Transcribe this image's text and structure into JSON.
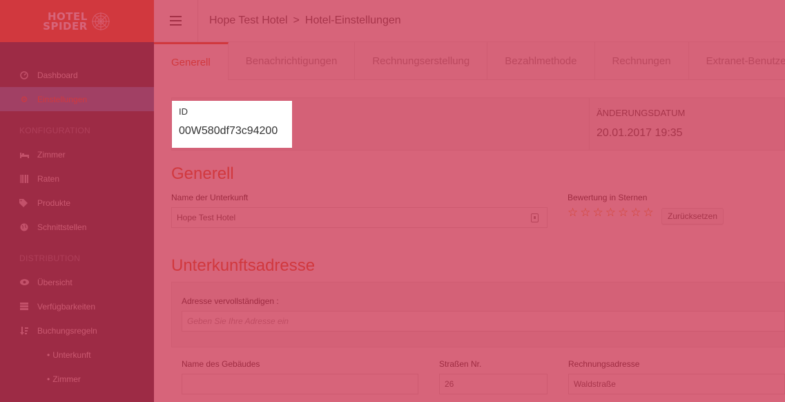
{
  "logo": {
    "line1": "HOTEL",
    "line2": "SPIDER"
  },
  "sidebar": {
    "items": [
      {
        "label": "Dashboard",
        "icon": "dashboard-icon",
        "active": false
      },
      {
        "label": "Einstellungen",
        "icon": "gear-icon",
        "active": true
      }
    ],
    "sections": [
      {
        "title": "KONFIGURATION",
        "items": [
          {
            "label": "Zimmer",
            "icon": "bed-icon"
          },
          {
            "label": "Raten",
            "icon": "barcode-icon"
          },
          {
            "label": "Produkte",
            "icon": "tags-icon"
          },
          {
            "label": "Schnittstellen",
            "icon": "globe-icon"
          }
        ]
      },
      {
        "title": "DISTRIBUTION",
        "items": [
          {
            "label": "Übersicht",
            "icon": "eye-icon"
          },
          {
            "label": "Verfügbarkeiten",
            "icon": "list-icon"
          },
          {
            "label": "Buchungsregeln",
            "icon": "sort-icon"
          }
        ],
        "subitems": [
          {
            "label": "Unterkunft"
          },
          {
            "label": "Zimmer"
          }
        ]
      }
    ]
  },
  "breadcrumb": {
    "hotel": "Hope Test Hotel",
    "separator": ">",
    "page": "Hotel-Einstellungen"
  },
  "tabs": [
    {
      "label": "Generell",
      "active": true
    },
    {
      "label": "Benachrichtigungen",
      "active": false
    },
    {
      "label": "Rechnungserstellung",
      "active": false
    },
    {
      "label": "Bezahlmethode",
      "active": false
    },
    {
      "label": "Rechnungen",
      "active": false
    },
    {
      "label": "Extranet-Benutzer",
      "active": false
    }
  ],
  "meta": {
    "id_label": "ID",
    "id_value": "00W580df73c94200",
    "date_label": "ÄNDERUNGSDATUM",
    "date_value": "20.01.2017 19:35"
  },
  "general": {
    "title": "Generell",
    "name_label": "Name der Unterkunft",
    "name_value": "Hope Test Hotel",
    "rating_label": "Bewertung in Sternen",
    "star_count": 7,
    "star_glyph": "☆",
    "reset_label": "Zurücksetzen"
  },
  "address": {
    "title": "Unterkunftsadresse",
    "complete_label": "Adresse vervollständigen :",
    "complete_placeholder": "Geben Sie Ihre Adresse ein",
    "building_label": "Name des Gebäudes",
    "building_value": "",
    "street_no_label": "Straßen Nr.",
    "street_no_value": "26",
    "billing_label": "Rechnungsadresse",
    "billing_value": "Waldstraße"
  },
  "colors": {
    "accent": "#e8632a",
    "sidebar": "#2f3542",
    "active_item": "#3e7fb0",
    "overlay": "#c82846"
  }
}
